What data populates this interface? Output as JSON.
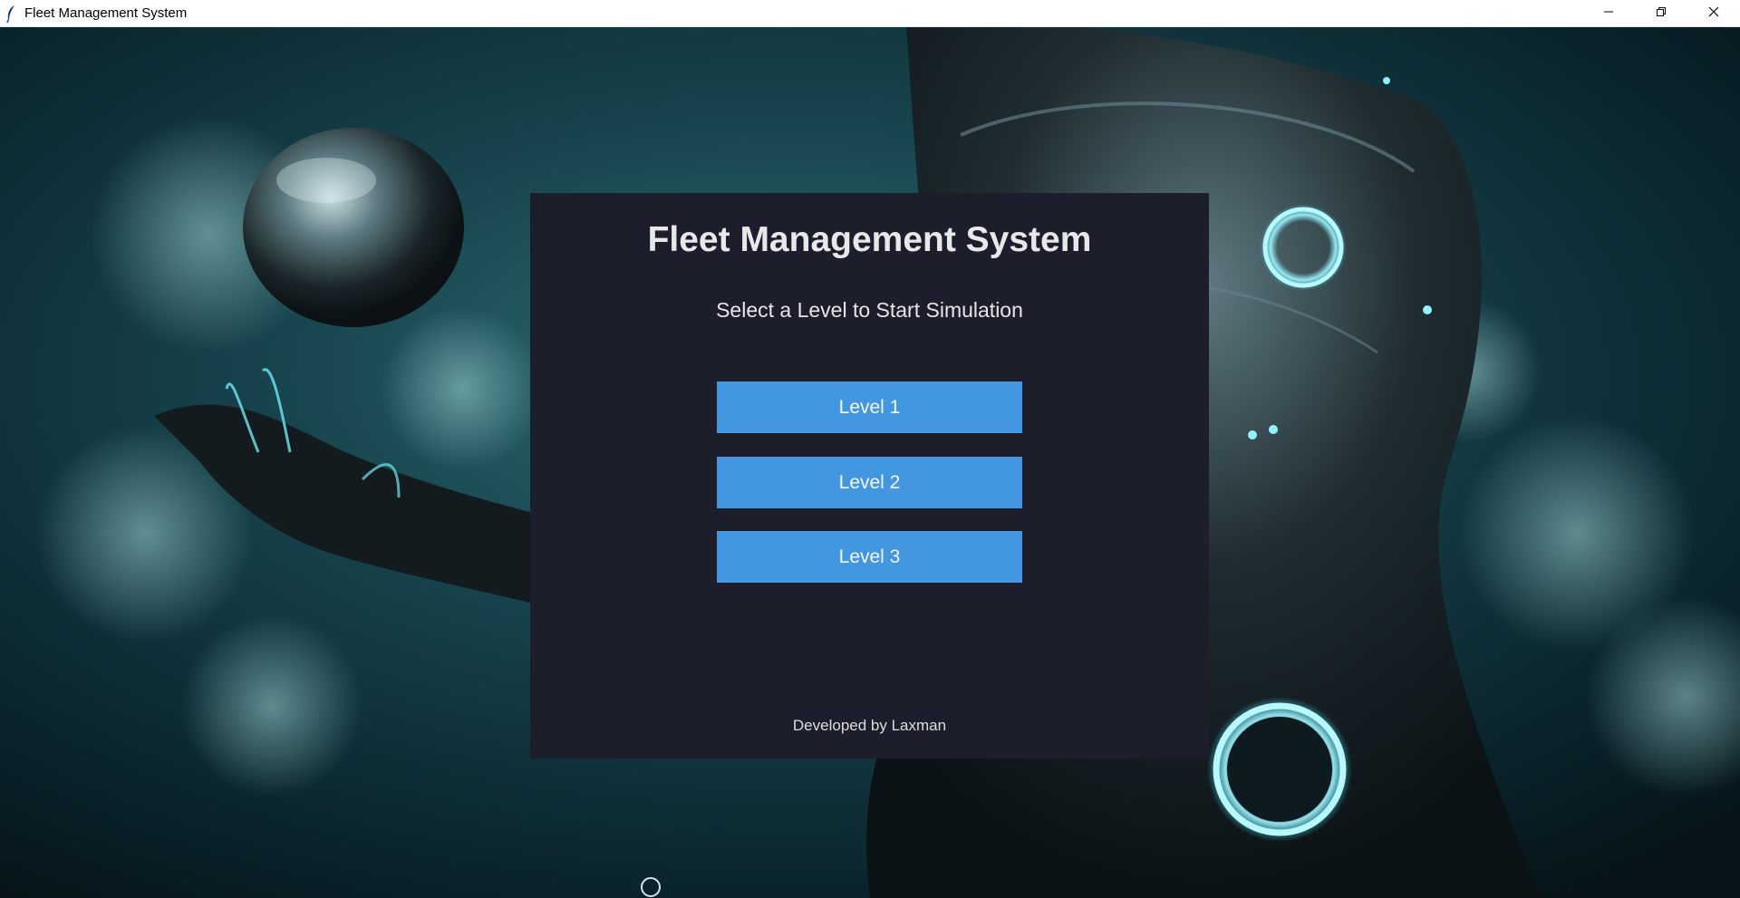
{
  "window": {
    "title": "Fleet Management System",
    "icon": "feather-icon",
    "controls": [
      "minimize-icon",
      "restore-icon",
      "close-icon"
    ]
  },
  "panel": {
    "title": "Fleet Management System",
    "subtitle": "Select a Level to Start Simulation",
    "buttons": [
      {
        "label": "Level 1"
      },
      {
        "label": "Level 2"
      },
      {
        "label": "Level 3"
      }
    ],
    "credit": "Developed by Laxman"
  },
  "colors": {
    "panel_bg": "#1c1f2b",
    "button_bg": "#4396e0",
    "title_text": "#e8e8ea",
    "background_tint": "#0f3a44"
  }
}
